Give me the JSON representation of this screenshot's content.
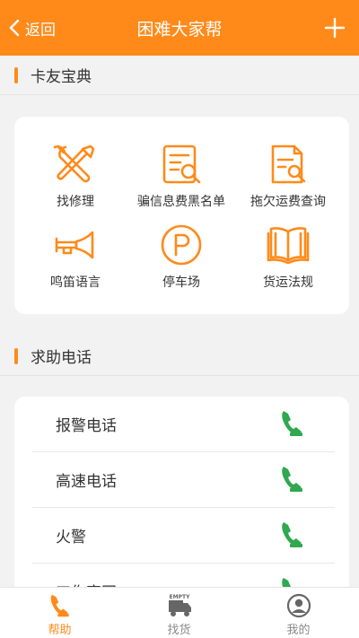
{
  "header": {
    "back_label": "返回",
    "title": "困难大家帮"
  },
  "tips_section": {
    "title": "卡友宝典",
    "items": [
      {
        "label": "找修理",
        "icon": "tools-icon"
      },
      {
        "label": "骗信息费黑名单",
        "icon": "blacklist-document-icon"
      },
      {
        "label": "拖欠运费查询",
        "icon": "freight-query-document-icon"
      },
      {
        "label": "鸣笛语言",
        "icon": "horn-icon"
      },
      {
        "label": "停车场",
        "icon": "parking-icon"
      },
      {
        "label": "货运法规",
        "icon": "book-icon"
      }
    ]
  },
  "hotline_section": {
    "title": "求助电话",
    "items": [
      {
        "label": "报警电话"
      },
      {
        "label": "高速电话"
      },
      {
        "label": "火警"
      },
      {
        "label": "工伤官网"
      }
    ]
  },
  "bottom_nav": {
    "items": [
      {
        "label": "帮助",
        "active": true
      },
      {
        "label": "找货",
        "active": false,
        "icon_text": "EMPTY"
      },
      {
        "label": "我的",
        "active": false
      }
    ]
  },
  "colors": {
    "accent": "#ff8a1a",
    "phone_green": "#2fa84f",
    "inactive": "#8a8a8a"
  }
}
